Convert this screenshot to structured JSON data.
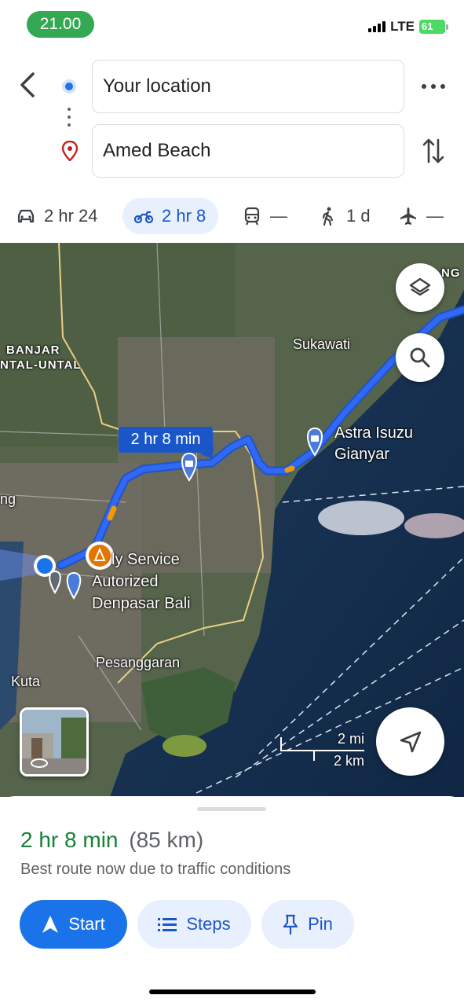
{
  "status_bar": {
    "time": "21.00",
    "network": "LTE",
    "battery": "61"
  },
  "directions": {
    "origin": "Your location",
    "destination": "Amed Beach"
  },
  "travel_modes": [
    {
      "mode": "car-icon",
      "label": "2 hr 24",
      "active": false
    },
    {
      "mode": "motorcycle-icon",
      "label": "2 hr 8",
      "active": true
    },
    {
      "mode": "train-icon",
      "label": "—",
      "active": false
    },
    {
      "mode": "walk-icon",
      "label": "1 d",
      "active": false
    },
    {
      "mode": "flight-icon",
      "label": "—",
      "active": false
    }
  ],
  "map": {
    "route_badge": "2 hr 8 min",
    "labels": {
      "banjar": "BANJAR",
      "untal": "NTAL-UNTAL",
      "sukawati": "Sukawati",
      "astra": "Astra Isuzu\nGianyar",
      "astra_line1": "Astra Isuzu",
      "astra_line2": "Gianyar",
      "service_line1": "ly Service",
      "service_line2": "Autorized",
      "service_line3": "Denpasar Bali",
      "pesanggaran": "Pesanggaran",
      "kuta": "Kuta",
      "ng_left": "ng",
      "ng_top": "NG"
    },
    "scale": {
      "imperial": "2 mi",
      "metric": "2 km"
    }
  },
  "route_sheet": {
    "duration": "2 hr 8 min",
    "distance": "(85 km)",
    "description": "Best route now due to traffic conditions",
    "buttons": {
      "start": "Start",
      "steps": "Steps",
      "pin": "Pin"
    }
  },
  "colors": {
    "accent": "#1a73e8",
    "route": "#3367f5",
    "duration_green": "#188038",
    "time_pill": "#34a853"
  }
}
